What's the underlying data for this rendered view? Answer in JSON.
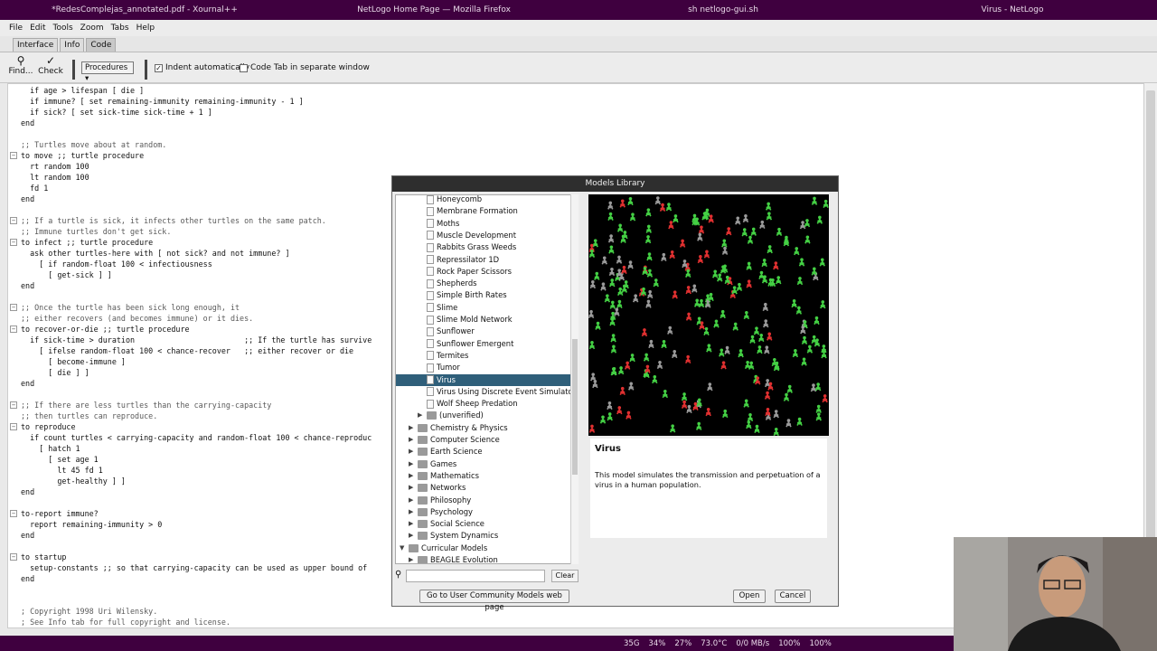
{
  "topbar": {
    "windows": [
      "*RedesComplejas_annotated.pdf - Xournal++",
      "NetLogo Home Page — Mozilla Firefox",
      "sh netlogo-gui.sh",
      "Virus - NetLogo"
    ]
  },
  "menubar": [
    "File",
    "Edit",
    "Tools",
    "Zoom",
    "Tabs",
    "Help"
  ],
  "tabs": [
    "Interface",
    "Info",
    "Code"
  ],
  "toolbar": {
    "find_label": "Find...",
    "check_label": "Check",
    "procedures_label": "Procedures",
    "indent_label": "Indent automatically",
    "separate_window_label": "Code Tab in separate window"
  },
  "code": [
    "  if age > lifespan [ die ]",
    "  if immune? [ set remaining-immunity remaining-immunity - 1 ]",
    "  if sick? [ set sick-time sick-time + 1 ]",
    "end",
    "",
    ";; Turtles move about at random.",
    "to move ;; turtle procedure",
    "  rt random 100",
    "  lt random 100",
    "  fd 1",
    "end",
    "",
    ";; If a turtle is sick, it infects other turtles on the same patch.",
    ";; Immune turtles don't get sick.",
    "to infect ;; turtle procedure",
    "  ask other turtles-here with [ not sick? and not immune? ]",
    "    [ if random-float 100 < infectiousness",
    "      [ get-sick ] ]",
    "end",
    "",
    ";; Once the turtle has been sick long enough, it",
    ";; either recovers (and becomes immune) or it dies.",
    "to recover-or-die ;; turtle procedure",
    "  if sick-time > duration                        ;; If the turtle has survive",
    "    [ ifelse random-float 100 < chance-recover   ;; either recover or die",
    "      [ become-immune ]",
    "      [ die ] ]",
    "end",
    "",
    ";; If there are less turtles than the carrying-capacity",
    ";; then turtles can reproduce.",
    "to reproduce",
    "  if count turtles < carrying-capacity and random-float 100 < chance-reproduc",
    "    [ hatch 1",
    "      [ set age 1",
    "        lt 45 fd 1",
    "        get-healthy ] ]",
    "end",
    "",
    "to-report immune?",
    "  report remaining-immunity > 0",
    "end",
    "",
    "to startup",
    "  setup-constants ;; so that carrying-capacity can be used as upper bound of",
    "end",
    "",
    "",
    "; Copyright 1998 Uri Wilensky.",
    "; See Info tab for full copyright and license."
  ],
  "dialog": {
    "title": "Models Library",
    "models": [
      "Honeycomb",
      "Membrane Formation",
      "Moths",
      "Muscle Development",
      "Rabbits Grass Weeds",
      "Repressilator 1D",
      "Rock Paper Scissors",
      "Shepherds",
      "Simple Birth Rates",
      "Slime",
      "Slime Mold Network",
      "Sunflower",
      "Sunflower Emergent",
      "Termites",
      "Tumor",
      "Virus",
      "Virus Using Discrete Event Simulator",
      "Wolf Sheep Predation"
    ],
    "selected": "Virus",
    "unverified": "(unverified)",
    "folders": [
      "Chemistry & Physics",
      "Computer Science",
      "Earth Science",
      "Games",
      "Mathematics",
      "Networks",
      "Philosophy",
      "Psychology",
      "Social Science",
      "System Dynamics"
    ],
    "curricular": "Curricular Models",
    "curricular_child": "BEAGLE Evolution",
    "info_title": "Virus",
    "info_text": "This model simulates the transmission and perpetuation of a virus in a human population.",
    "clear_label": "Clear",
    "community_label": "Go to User Community Models web page",
    "open_label": "Open",
    "cancel_label": "Cancel",
    "search_placeholder": ""
  },
  "colors": {
    "taskbar": "#3f003f",
    "selection": "#2f5f7a",
    "sick": "#e03030",
    "healthy": "#44d044",
    "immune": "#9a9a9a"
  },
  "statusbar": {
    "disk": "35G",
    "cpu": "27%",
    "temp": "73.0°C",
    "net": "0/0 MB/s",
    "volume": "100%",
    "brightness": "100%",
    "battery": "34%"
  }
}
